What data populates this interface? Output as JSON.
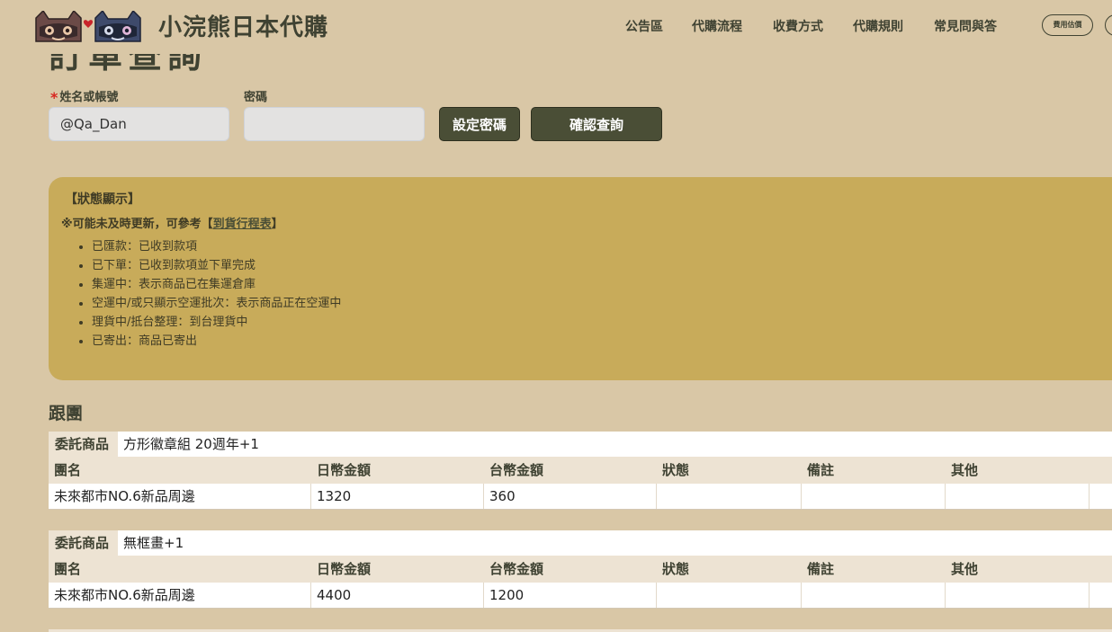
{
  "header": {
    "brand": "小浣熊日本代購",
    "nav": [
      {
        "label": "公告區"
      },
      {
        "label": "代購流程"
      },
      {
        "label": "收費方式"
      },
      {
        "label": "代購規則"
      },
      {
        "label": "常見問與答"
      }
    ],
    "pill_label": "費用估價"
  },
  "page": {
    "title": "訂單查詢"
  },
  "form": {
    "name_label": "姓名或帳號",
    "name_value": "@Qa_Dan",
    "password_label": "密碼",
    "password_value": "",
    "set_password_label": "設定密碼",
    "confirm_label": "確認查詢"
  },
  "status": {
    "title": "【狀態顯示】",
    "note_prefix": "※可能未及時更新，可參考",
    "note_link_open": "【",
    "note_link": "到貨行程表",
    "note_link_close": "】",
    "items": [
      "已匯款：已收到款項",
      "已下單：已收到款項並下單完成",
      "集運中：表示商品已在集運倉庫",
      "空運中/或只顯示空運批次：表示商品正在空運中",
      "理貨中/抵台整理：到台理貨中",
      "已寄出：商品已寄出"
    ]
  },
  "section": {
    "title": "跟團"
  },
  "table": {
    "product_label": "委託商品",
    "headers": [
      "團名",
      "日幣金額",
      "台幣金額",
      "狀態",
      "備註",
      "其他"
    ]
  },
  "orders": [
    {
      "product": "方形徽章組 20週年+1",
      "row": [
        "未來都市NO.6新品周邊",
        "1320",
        "360",
        "",
        "",
        ""
      ]
    },
    {
      "product": "無框畫+1",
      "row": [
        "未來都市NO.6新品周邊",
        "4400",
        "1200",
        "",
        "",
        ""
      ]
    }
  ],
  "colors": {
    "background": "#d9c7a6",
    "accent_dark": "#4a4e36",
    "status_box": "#c8ab5a",
    "required": "#d8261f"
  }
}
